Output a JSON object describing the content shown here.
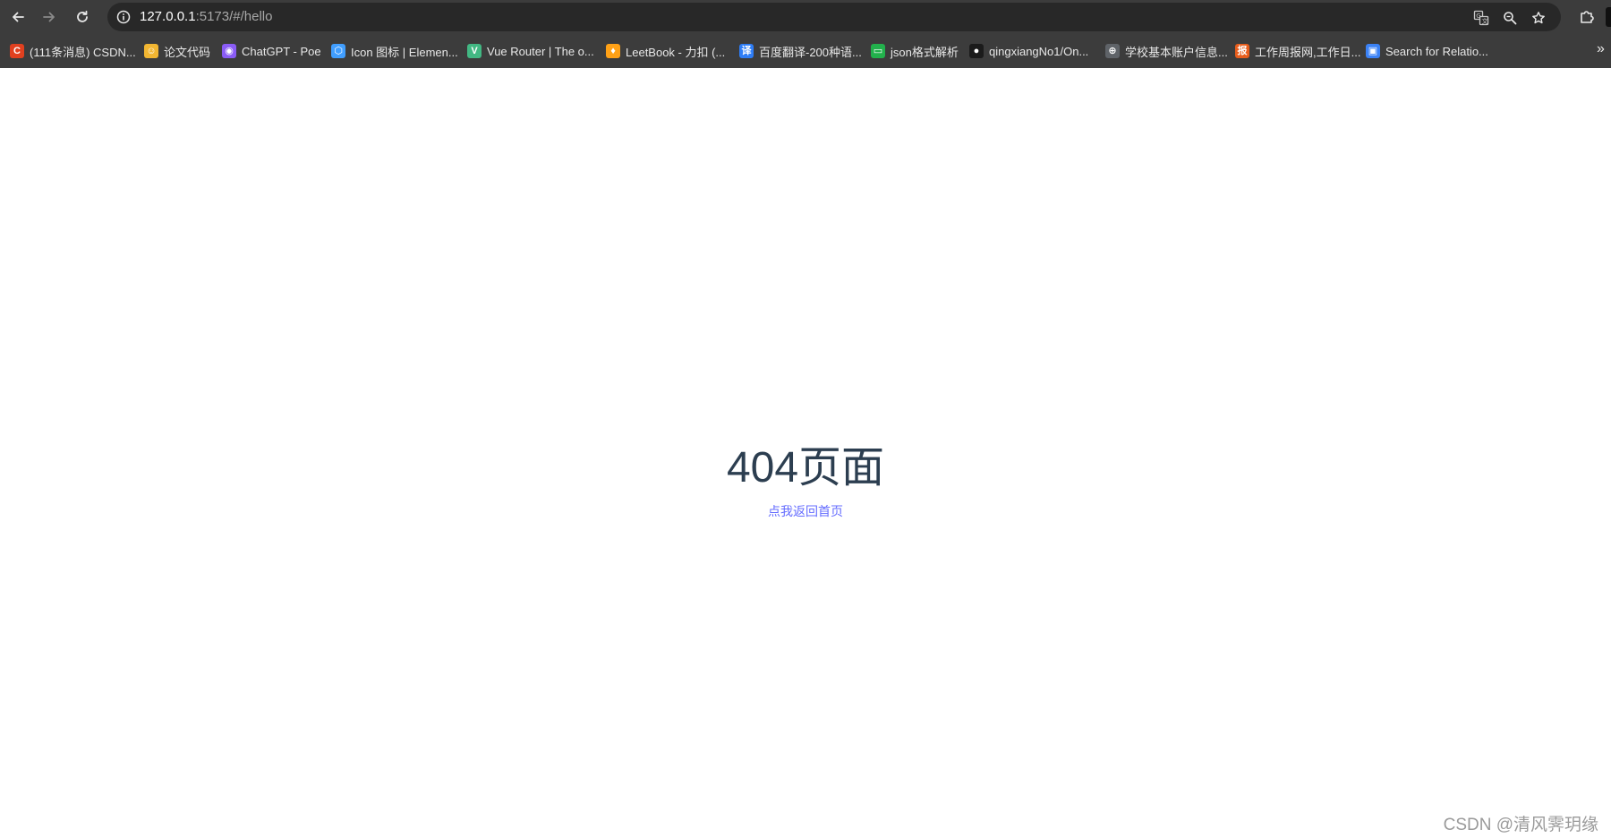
{
  "browser": {
    "url_host": "127.0.0.1",
    "url_path": ":5173/#/hello",
    "icons": {
      "back": "arrow-left-icon",
      "forward": "arrow-right-icon",
      "reload": "reload-icon",
      "site_info": "info-circle-icon",
      "translate": "translate-icon",
      "zoom": "zoom-icon",
      "bookmark_star": "star-icon",
      "extensions": "puzzle-icon"
    }
  },
  "bookmarks": [
    {
      "label": "(111条消息) CSDN...",
      "icon": "csdn-icon",
      "color": "#e0401f",
      "glyph": "C"
    },
    {
      "label": "论文代码",
      "icon": "emoji-icon",
      "color": "#f2b632",
      "glyph": "☺"
    },
    {
      "label": "ChatGPT - Poe",
      "icon": "poe-icon",
      "color": "#8a5cf6",
      "glyph": "◉"
    },
    {
      "label": "Icon 图标 | Elemen...",
      "icon": "element-icon",
      "color": "#409eff",
      "glyph": "⬡"
    },
    {
      "label": "Vue Router | The o...",
      "icon": "vue-icon",
      "color": "#42b883",
      "glyph": "V"
    },
    {
      "label": "LeetBook - 力扣 (...",
      "icon": "leetcode-icon",
      "color": "#ffa116",
      "glyph": "♦"
    },
    {
      "label": "百度翻译-200种语...",
      "icon": "baidu-translate-icon",
      "color": "#2e7df6",
      "glyph": "译"
    },
    {
      "label": "json格式解析",
      "icon": "json-icon",
      "color": "#22b14c",
      "glyph": "▭"
    },
    {
      "label": "qingxiangNo1/On...",
      "icon": "github-icon",
      "color": "#1b1b1b",
      "glyph": "●"
    },
    {
      "label": "学校基本账户信息...",
      "icon": "globe-icon",
      "color": "#5f6368",
      "glyph": "⊕"
    },
    {
      "label": "工作周报网,工作日...",
      "icon": "report-icon",
      "color": "#e85d1c",
      "glyph": "报"
    },
    {
      "label": "Search for Relatio...",
      "icon": "search-page-icon",
      "color": "#3b82f6",
      "glyph": "▣"
    }
  ],
  "page": {
    "heading": "404页面",
    "back_link": "点我返回首页",
    "watermark": "CSDN @清风霁玥缘"
  },
  "colors": {
    "chrome_bg": "#3c3c3c",
    "omnibox_bg": "#282828",
    "heading": "#2c3e50",
    "link": "#646cff"
  }
}
